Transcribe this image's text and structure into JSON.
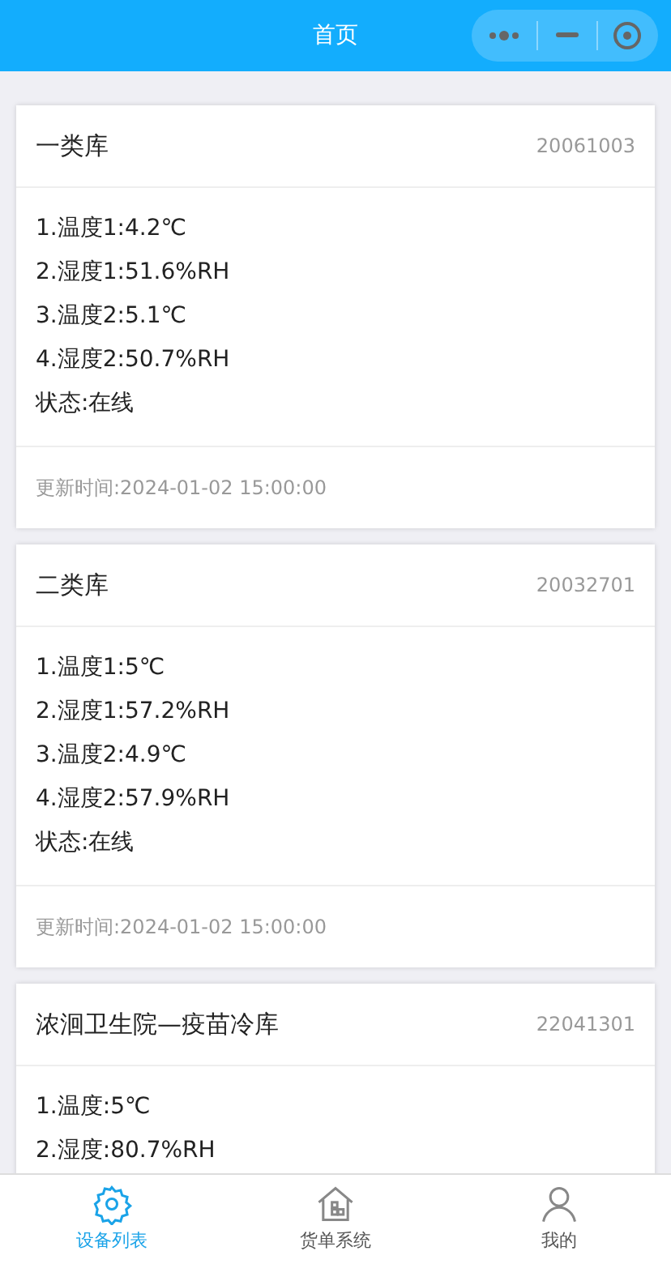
{
  "header": {
    "title": "首页"
  },
  "devices": [
    {
      "name": "一类库",
      "code": "20061003",
      "readings": [
        "1.温度1:4.2℃",
        "2.湿度1:51.6%RH",
        "3.温度2:5.1℃",
        "4.湿度2:50.7%RH",
        "状态:在线"
      ],
      "updated": "更新时间:2024-01-02 15:00:00"
    },
    {
      "name": "二类库",
      "code": "20032701",
      "readings": [
        "1.温度1:5℃",
        "2.湿度1:57.2%RH",
        "3.温度2:4.9℃",
        "4.湿度2:57.9%RH",
        "状态:在线"
      ],
      "updated": "更新时间:2024-01-02 15:00:00"
    },
    {
      "name": "浓洄卫生院—疫苗冷库",
      "code": "22041301",
      "readings": [
        "1.温度:5℃",
        "2.湿度:80.7%RH"
      ]
    }
  ],
  "tabbar": [
    {
      "label": "设备列表",
      "kind": "gear",
      "selected": true
    },
    {
      "label": "货单系统",
      "kind": "house",
      "selected": false
    },
    {
      "label": "我的",
      "kind": "person",
      "selected": false
    }
  ]
}
